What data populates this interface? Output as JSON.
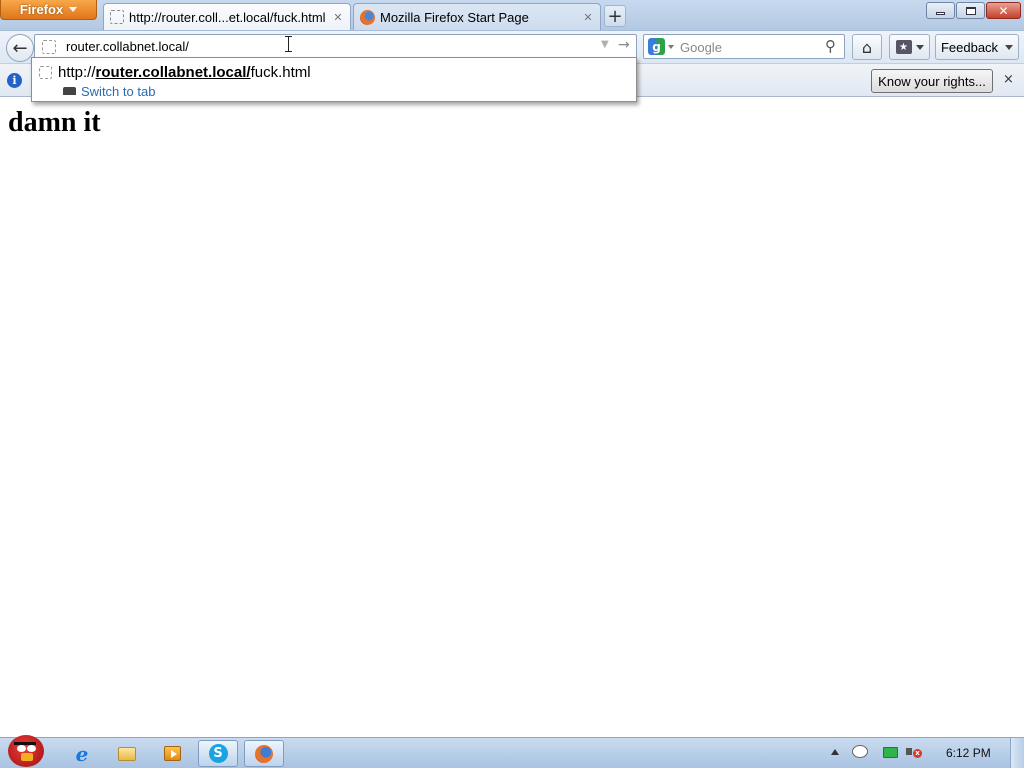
{
  "app_menu": {
    "label": "Firefox"
  },
  "tabs": [
    {
      "title": "http://router.coll...et.local/fuck.html",
      "active": true
    },
    {
      "title": "Mozilla Firefox Start Page",
      "active": false
    }
  ],
  "new_tab": {
    "symbol": "+"
  },
  "window_controls": {
    "close_symbol": "✕"
  },
  "navbar": {
    "back_symbol": "←",
    "url_value": "router.collabnet.local/",
    "url_go_symbol": "→",
    "url_dropmarker_symbol": "▼",
    "search_engine_letter": "g",
    "search_placeholder": "Google",
    "search_go_symbol": "⚲",
    "home_symbol": "⌂",
    "bookmark_symbol": "★",
    "feedback_label": "Feedback"
  },
  "autocomplete": {
    "prefix": "http://",
    "match": "router.collabnet.local/",
    "suffix": "fuck.html",
    "action": "Switch to tab"
  },
  "notification": {
    "info_symbol": "i",
    "button_label": "Know your rights...",
    "close_symbol": "×"
  },
  "page": {
    "heading": "damn it"
  },
  "taskbar": {
    "ie_letter": "e",
    "skype_letter": "S",
    "clock": "6:12 PM"
  },
  "icons": {
    "app_button_color": "#e1761a",
    "info_color": "#2461c7",
    "link_color": "#2a6cb2"
  }
}
